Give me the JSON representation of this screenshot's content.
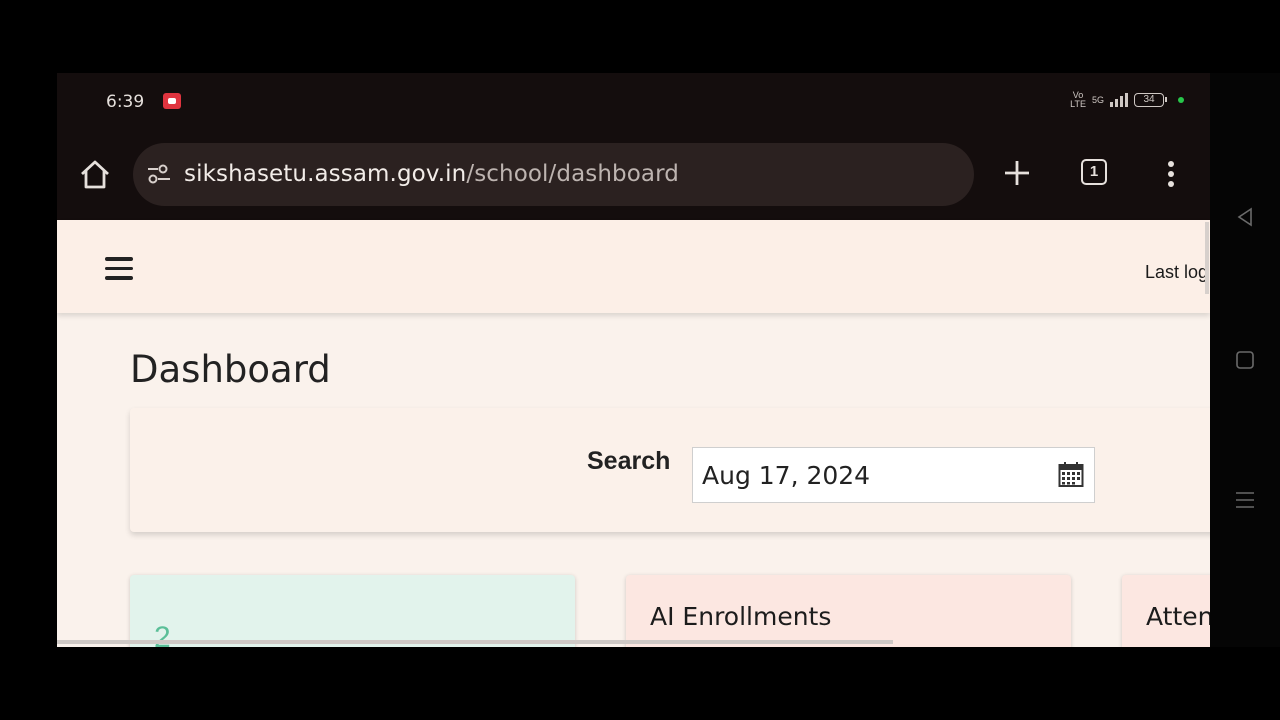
{
  "status_bar": {
    "time": "6:39",
    "network_label_1": "Vo",
    "network_label_2": "LTE",
    "network_type": "5G",
    "battery": "34"
  },
  "browser": {
    "url_host": "sikshasetu.assam.gov.in",
    "url_path": "/school/dashboard",
    "tab_count": "1"
  },
  "page": {
    "last_login": "Last log",
    "title": "Dashboard",
    "search_label": "Search",
    "date_value": "Aug 17, 2024",
    "cards": [
      {
        "number": "2",
        "title": ""
      },
      {
        "title": "AI Enrollments"
      },
      {
        "title": "Atten"
      }
    ]
  },
  "colors": {
    "status_dot": "#27c64a",
    "record_icon": "#e0343f",
    "card_green": "#e2f3ec",
    "card_pink": "#fce7e1"
  }
}
